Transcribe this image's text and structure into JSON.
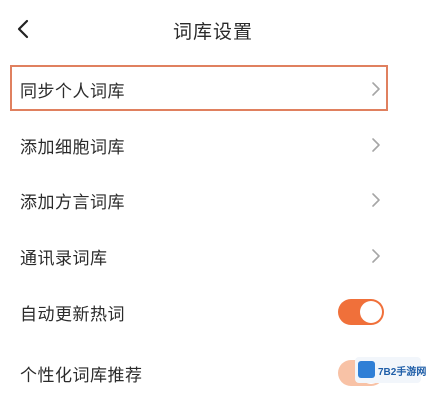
{
  "header": {
    "title": "词库设置",
    "back_icon": "chevron-left-icon"
  },
  "rows": [
    {
      "label": "同步个人词库",
      "trailing": "chevron-right-icon",
      "highlighted": true
    },
    {
      "label": "添加细胞词库",
      "trailing": "chevron-right-icon"
    },
    {
      "label": "添加方言词库",
      "trailing": "chevron-right-icon"
    },
    {
      "label": "通讯录词库",
      "trailing": "chevron-right-icon"
    },
    {
      "label": "自动更新热词",
      "trailing": "toggle",
      "toggle_on": true
    },
    {
      "label": "个性化词库推荐",
      "trailing": "toggle",
      "toggle_on": true
    }
  ],
  "colors": {
    "accent": "#f0703a",
    "highlight_border": "#e0805f",
    "chevron": "#a6a6a6",
    "text": "#2b2b2b"
  },
  "watermark": {
    "text": "7B2手游网"
  }
}
